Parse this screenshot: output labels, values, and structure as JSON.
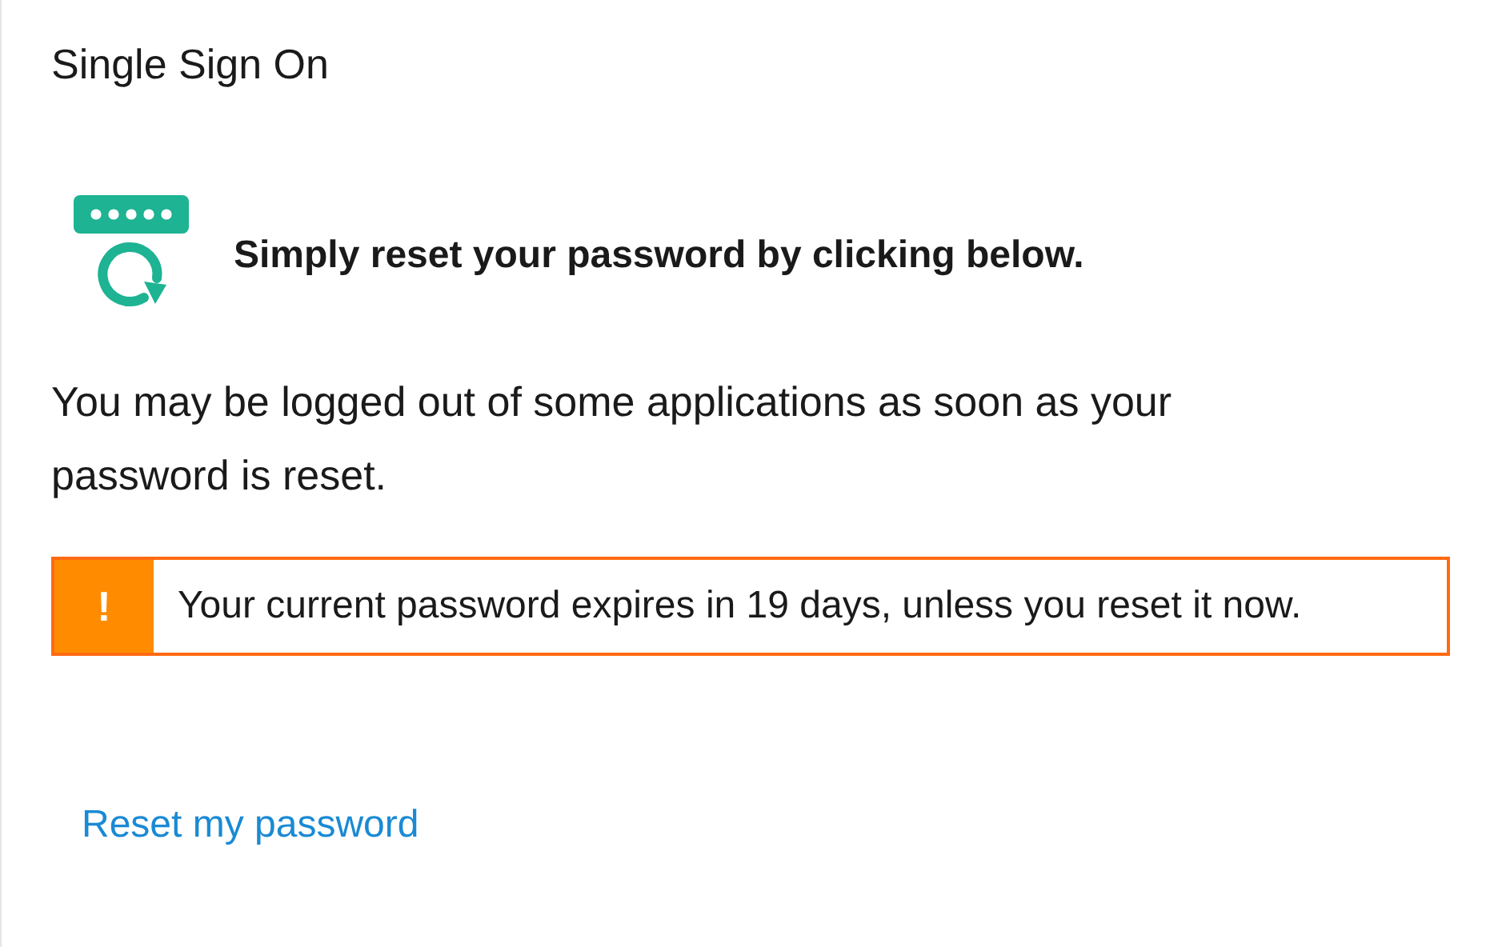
{
  "title": "Single Sign On",
  "heading": "Simply reset your password by clicking below.",
  "description": "You may be logged out of some applications as soon as your password is reset.",
  "alert": {
    "kind": "warning",
    "symbol": "!",
    "message": "Your current password expires in 19 days, unless you reset it now."
  },
  "link": "Reset my password"
}
